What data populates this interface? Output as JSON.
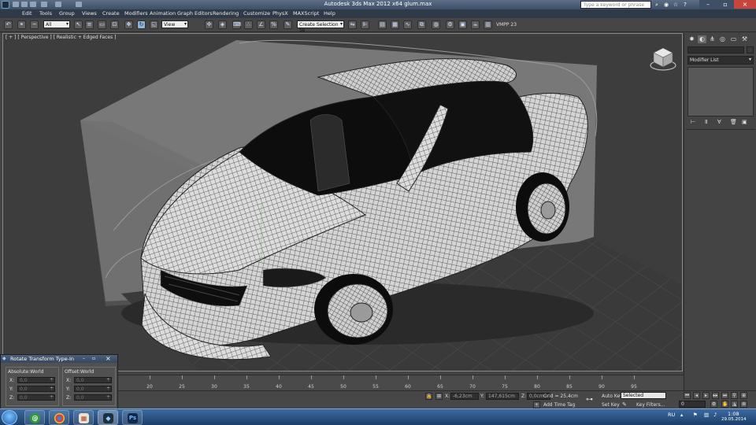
{
  "window": {
    "title": "Autodesk 3ds Max  2012 x64    glum.max",
    "search_placeholder": "Type a keyword or phrase"
  },
  "menu": [
    "Edit",
    "Tools",
    "Group",
    "Views",
    "Create",
    "Modifiers",
    "Animation",
    "Graph Editors",
    "Rendering",
    "Customize",
    "PhysX",
    "MAXScript",
    "Help"
  ],
  "toolbar": {
    "filter": "All",
    "ref_coord": "View",
    "selection_set": "Create Selection Se",
    "vmpp": "VMPP 23"
  },
  "viewport": {
    "label": "[ + ] [ Perspective ] [ Realistic + Edged Faces ]"
  },
  "command_panel": {
    "modifier_list": "Modifier List"
  },
  "typein": {
    "title": "Rotate Transform Type-In",
    "absolute_label": "Absolute:World",
    "offset_label": "Offset:World",
    "abs_x": "0,0",
    "abs_y": "0,0",
    "abs_z": "0,0",
    "off_x": "0,0",
    "off_y": "0,0",
    "off_z": "0,0",
    "axis_x": "X:",
    "axis_y": "Y:",
    "axis_z": "Z:"
  },
  "trackbar": {
    "ticks": [
      "20",
      "25",
      "30",
      "35",
      "40",
      "45",
      "50",
      "55",
      "60",
      "65",
      "70",
      "75",
      "80",
      "85",
      "90",
      "95"
    ]
  },
  "status": {
    "x_label": "X:",
    "x_value": "-6,23cm",
    "y_label": "Y:",
    "y_value": "147,615cm",
    "z_label": "Z:",
    "z_value": "0,0cm",
    "grid": "Grid = 25,4cm",
    "add_time_tag": "Add Time Tag",
    "auto_key": "Auto Key",
    "selected": "Selected",
    "set_key": "Set Key",
    "key_filters": "Key Filters...",
    "frame": "0"
  },
  "taskbar": {
    "lang": "RU",
    "time": "1:08",
    "date": "29.05.2014"
  }
}
